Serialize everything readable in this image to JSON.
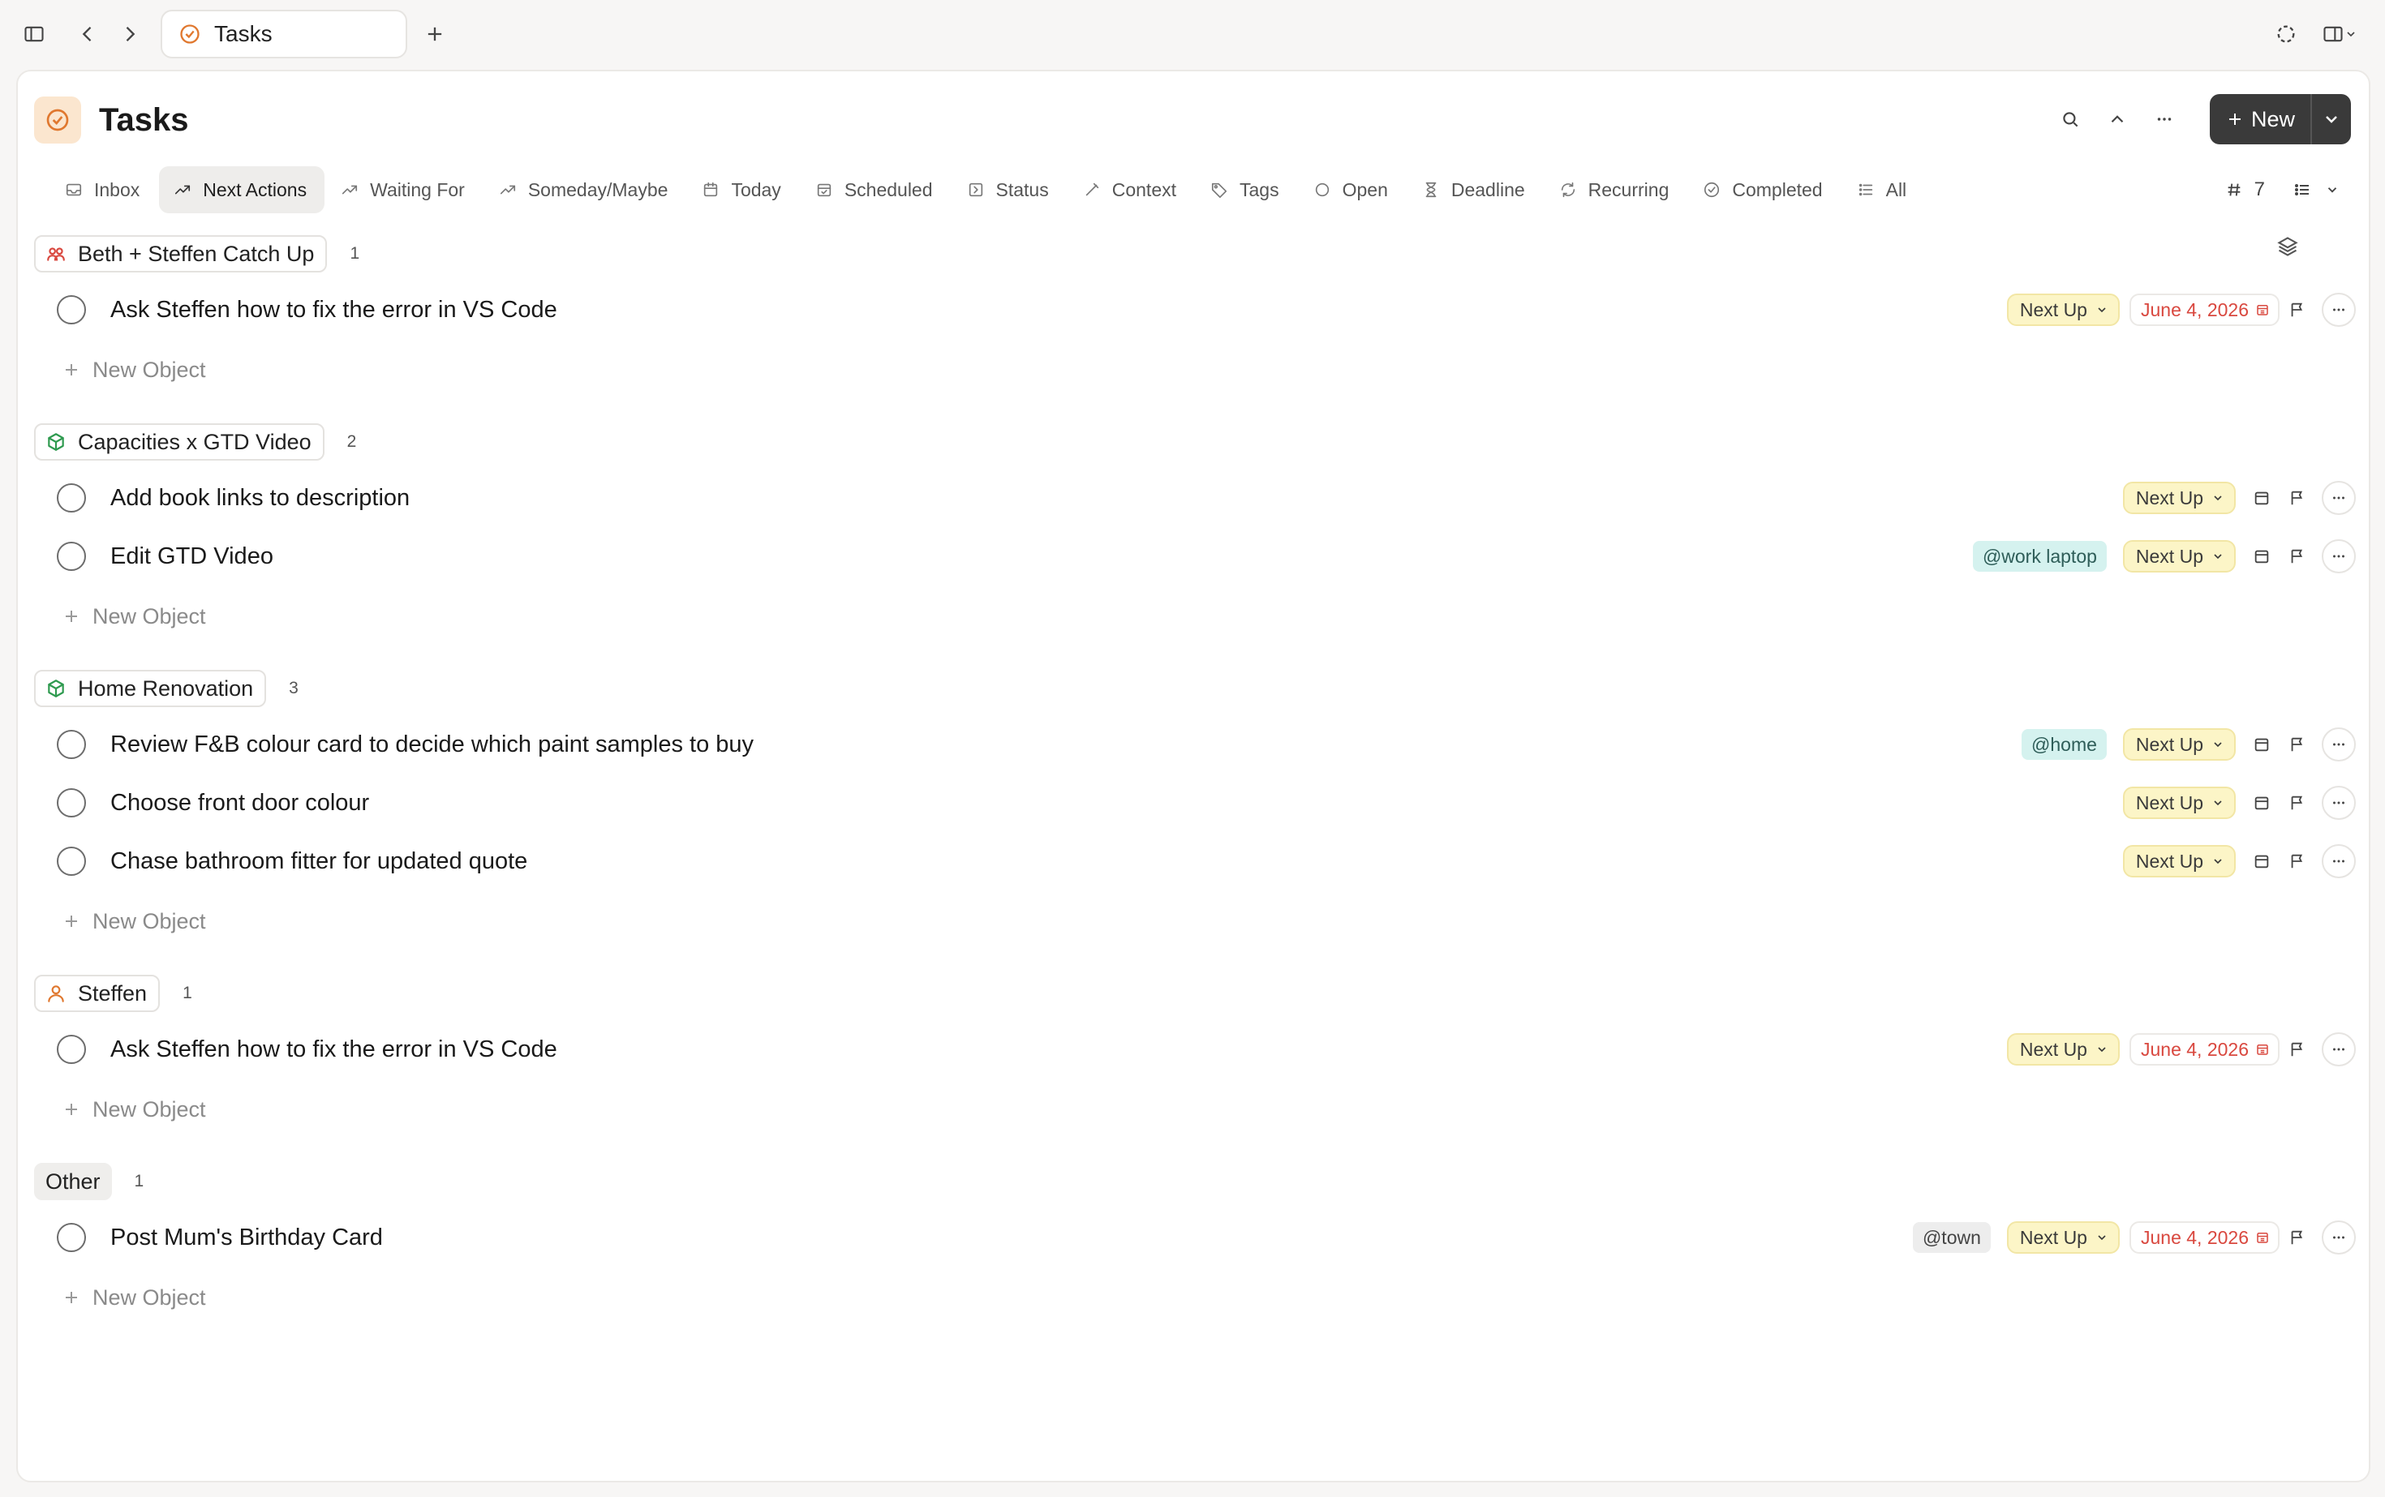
{
  "window": {
    "tab_title": "Tasks",
    "icons": [
      "sidebar-toggle-icon",
      "back-icon",
      "forward-icon",
      "plus-icon",
      "sync-icon",
      "split-view-icon"
    ]
  },
  "page": {
    "title": "Tasks",
    "new_label": "New"
  },
  "views": [
    {
      "label": "Inbox",
      "icon": "inbox-icon"
    },
    {
      "label": "Next Actions",
      "icon": "trending-up-icon",
      "active": true
    },
    {
      "label": "Waiting For",
      "icon": "trending-up-icon"
    },
    {
      "label": "Someday/Maybe",
      "icon": "trending-up-icon"
    },
    {
      "label": "Today",
      "icon": "calendar-icon"
    },
    {
      "label": "Scheduled",
      "icon": "calendar-check-icon"
    },
    {
      "label": "Status",
      "icon": "status-icon"
    },
    {
      "label": "Context",
      "icon": "pencil-icon"
    },
    {
      "label": "Tags",
      "icon": "tag-icon"
    },
    {
      "label": "Open",
      "icon": "circle-icon"
    },
    {
      "label": "Deadline",
      "icon": "hourglass-icon"
    },
    {
      "label": "Recurring",
      "icon": "recurring-icon"
    },
    {
      "label": "Completed",
      "icon": "check-circle-icon"
    },
    {
      "label": "All",
      "icon": "list-icon"
    }
  ],
  "count": "7",
  "new_object_label": "New Object",
  "groups": [
    {
      "name": "Beth + Steffen Catch Up",
      "count": "1",
      "icon": "people-icon",
      "icon_color": "#d9483f",
      "tasks": [
        {
          "title": "Ask Steffen how to fix the error in VS Code",
          "status": "Next Up",
          "date": "June 4, 2026"
        }
      ]
    },
    {
      "name": "Capacities x GTD Video",
      "count": "2",
      "icon": "cube-icon",
      "icon_color": "#2e9a4f",
      "tasks": [
        {
          "title": "Add book links to description",
          "status": "Next Up"
        },
        {
          "title": "Edit GTD Video",
          "status": "Next Up",
          "context": "@work laptop"
        }
      ]
    },
    {
      "name": "Home Renovation",
      "count": "3",
      "icon": "cube-icon",
      "icon_color": "#2e9a4f",
      "tasks": [
        {
          "title": "Review F&B colour card to decide which paint samples to buy",
          "status": "Next Up",
          "context": "@home"
        },
        {
          "title": "Choose front door colour",
          "status": "Next Up"
        },
        {
          "title": "Chase bathroom fitter for updated quote",
          "status": "Next Up"
        }
      ]
    },
    {
      "name": "Steffen",
      "count": "1",
      "icon": "person-icon",
      "icon_color": "#e0782f",
      "tasks": [
        {
          "title": "Ask Steffen how to fix the error in VS Code",
          "status": "Next Up",
          "date": "June 4, 2026"
        }
      ]
    },
    {
      "name": "Other",
      "count": "1",
      "tasks": [
        {
          "title": "Post Mum's Birthday Card",
          "status": "Next Up",
          "date": "June 4, 2026",
          "context": "@town"
        }
      ]
    }
  ],
  "colors": {
    "accent_orange": "#e0782f",
    "date_red": "#d9483f",
    "status_yellow": "#fcf5c7",
    "context_teal": "#d5f2ef",
    "new_button": "#3a3a3a"
  }
}
